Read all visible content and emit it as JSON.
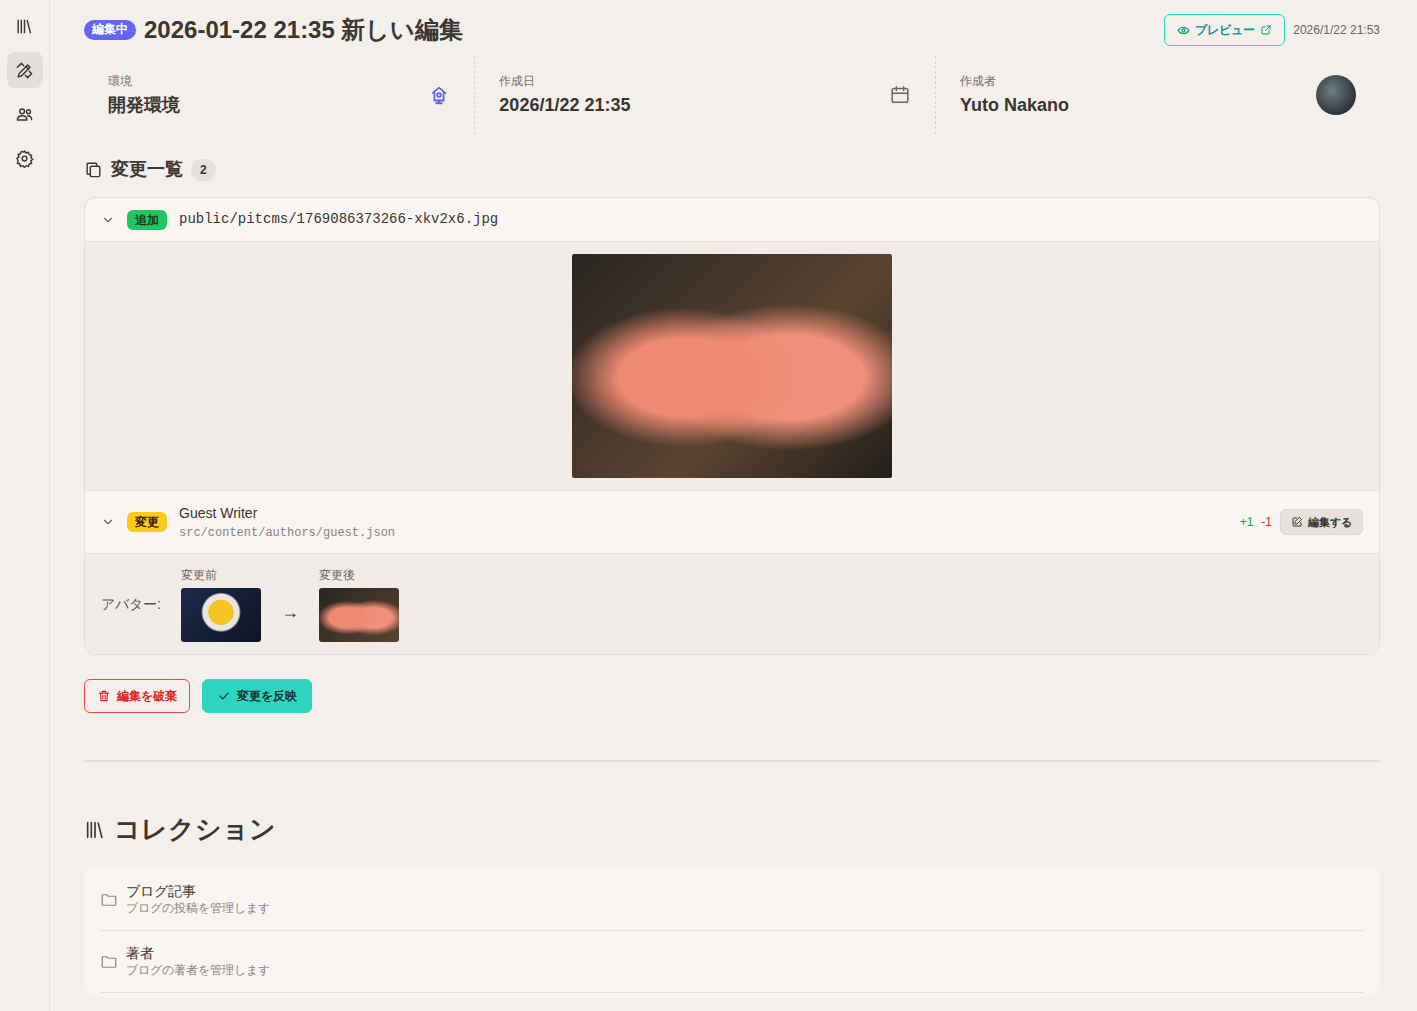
{
  "sidebar": {
    "items": [
      {
        "selected": false
      },
      {
        "selected": true
      },
      {
        "selected": false
      },
      {
        "selected": false
      }
    ]
  },
  "header": {
    "status_badge": "編集中",
    "title": "2026-01-22 21:35 新しい編集",
    "preview_button": "プレビュー",
    "updated": "2026/1/22 21:53"
  },
  "info": [
    {
      "label": "環境",
      "value": "開発環境"
    },
    {
      "label": "作成日",
      "value": "2026/1/22 21:35"
    },
    {
      "label": "作成者",
      "value": "Yuto Nakano"
    }
  ],
  "changes": {
    "title": "変更一覧",
    "count": "2",
    "items": [
      {
        "kind": "image",
        "badge": "追加",
        "color": "#22c55e",
        "path": "public/pitcms/1769086373266-xkv2x6.jpg",
        "expanded": true
      },
      {
        "kind": "field",
        "badge": "変更",
        "color": "#facc15",
        "title": "Guest Writer",
        "path": "src/content/authors/guest.json",
        "added": "+1",
        "removed": "-1",
        "edit_button": "編集する",
        "expanded": true,
        "field": {
          "label": "アバター:",
          "before_label": "変更前",
          "arrow": "→",
          "after_label": "変更後"
        }
      }
    ]
  },
  "actions": {
    "discard": "編集を破棄",
    "apply": "変更を反映"
  },
  "collections": {
    "title": "コレクション",
    "items": [
      {
        "name": "ブログ記事",
        "description": "ブログの投稿を管理します"
      },
      {
        "name": "著者",
        "description": "ブログの著者を管理します"
      }
    ]
  }
}
